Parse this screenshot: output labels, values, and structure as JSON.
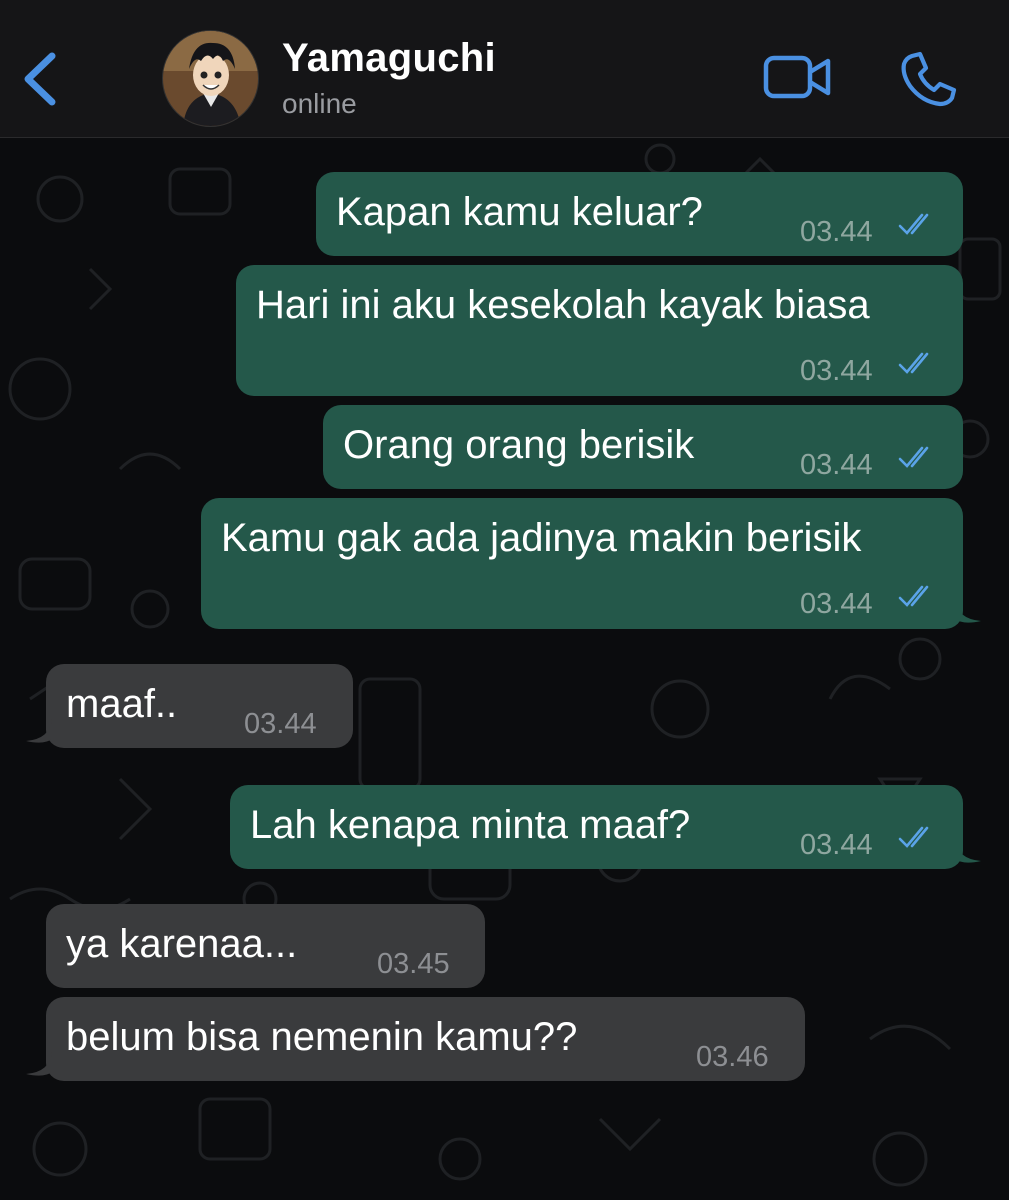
{
  "header": {
    "contact_name": "Yamaguchi",
    "status": "online"
  },
  "colors": {
    "accent": "#4a90e2",
    "outgoing_bubble": "#24584a",
    "incoming_bubble": "#3a3b3d",
    "read_tick": "#5aa3e8"
  },
  "messages": [
    {
      "direction": "outgoing",
      "text": "Kapan kamu keluar?",
      "time": "03.44",
      "status": "read"
    },
    {
      "direction": "outgoing",
      "text": "Hari ini aku kesekolah kayak biasa",
      "time": "03.44",
      "status": "read"
    },
    {
      "direction": "outgoing",
      "text": "Orang orang berisik",
      "time": "03.44",
      "status": "read"
    },
    {
      "direction": "outgoing",
      "text": "Kamu gak ada jadinya makin berisik",
      "time": "03.44",
      "status": "read"
    },
    {
      "direction": "incoming",
      "text": "maaf..",
      "time": "03.44"
    },
    {
      "direction": "outgoing",
      "text": "Lah kenapa minta maaf?",
      "time": "03.44",
      "status": "read"
    },
    {
      "direction": "incoming",
      "text": "ya karenaa...",
      "time": "03.45"
    },
    {
      "direction": "incoming",
      "text": "belum bisa nemenin kamu??",
      "time": "03.46"
    }
  ]
}
